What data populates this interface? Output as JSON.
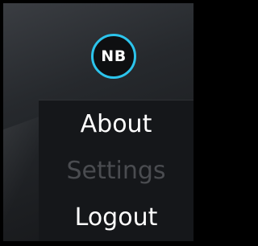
{
  "user": {
    "initials": "NB"
  },
  "menu": {
    "items": [
      {
        "label": "About",
        "state": "enabled"
      },
      {
        "label": "Settings",
        "state": "disabled"
      },
      {
        "label": "Logout",
        "state": "enabled"
      }
    ]
  },
  "colors": {
    "accent": "#2cc4ec",
    "menu_background": "#15171a",
    "item_text": "#ffffff",
    "disabled_text": "#4a4c50"
  }
}
